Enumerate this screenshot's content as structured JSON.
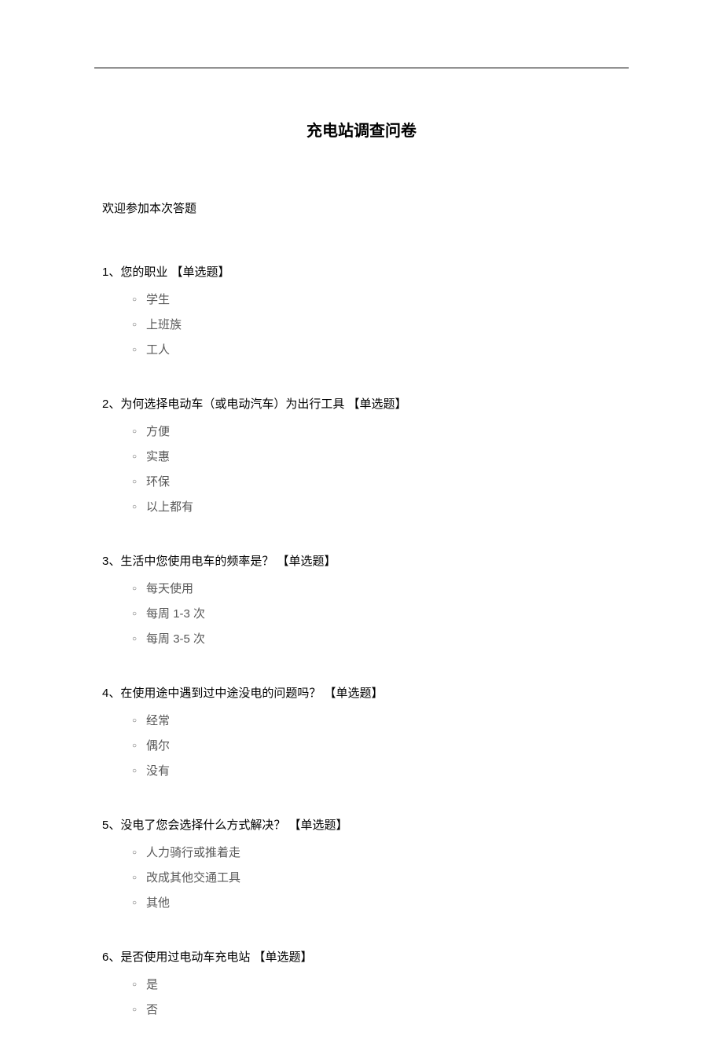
{
  "title": "充电站调查问卷",
  "welcome": "欢迎参加本次答题",
  "questions": [
    {
      "number": "1",
      "text": "您的职业",
      "type_label": "【单选题】",
      "options": [
        "学生",
        "上班族",
        "工人"
      ]
    },
    {
      "number": "2",
      "text": "为何选择电动车（或电动汽车）为出行工具",
      "type_label": "【单选题】",
      "options": [
        "方便",
        "实惠",
        "环保",
        "以上都有"
      ]
    },
    {
      "number": "3",
      "text": "生活中您使用电车的频率是？",
      "type_label": "【单选题】",
      "options": [
        "每天使用",
        "每周 1-3 次",
        "每周 3-5 次"
      ]
    },
    {
      "number": "4",
      "text": "在使用途中遇到过中途没电的问题吗？",
      "type_label": "【单选题】",
      "options": [
        "经常",
        "偶尔",
        "没有"
      ]
    },
    {
      "number": "5",
      "text": "没电了您会选择什么方式解决？",
      "type_label": "【单选题】",
      "options": [
        "人力骑行或推着走",
        "改成其他交通工具",
        "其他"
      ]
    },
    {
      "number": "6",
      "text": "是否使用过电动车充电站",
      "type_label": "【单选题】",
      "options": [
        "是",
        "否"
      ]
    }
  ],
  "separator": "、"
}
